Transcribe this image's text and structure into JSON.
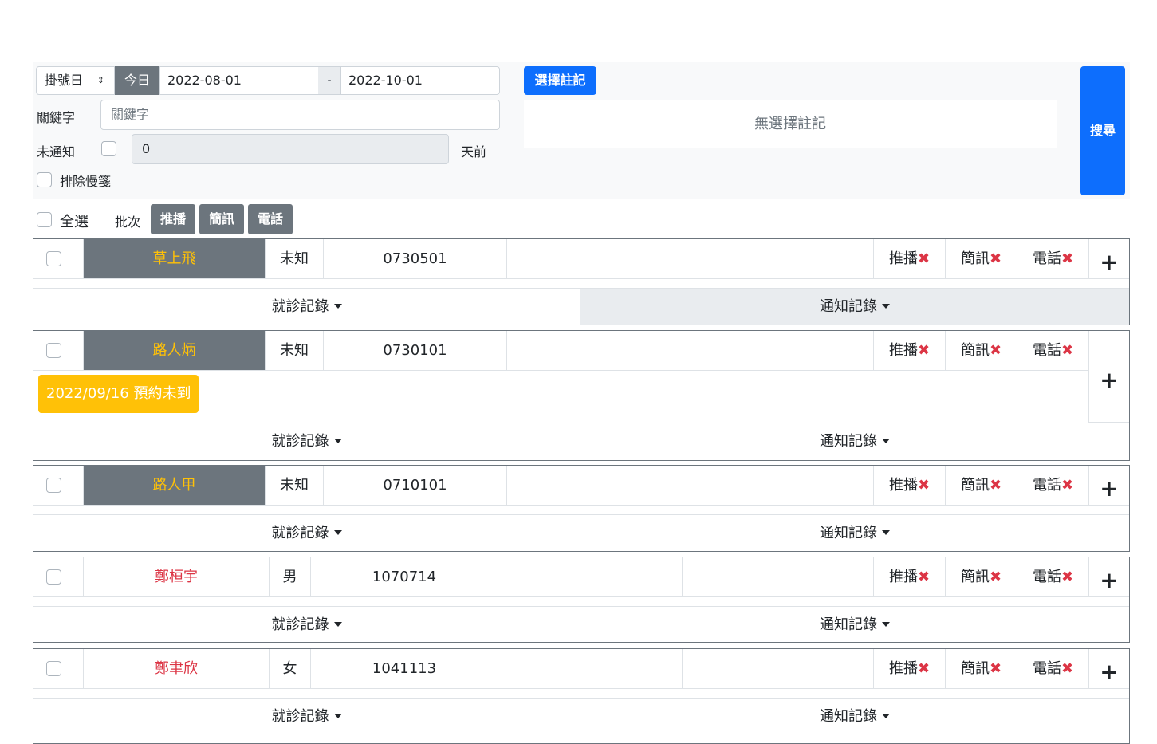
{
  "filters": {
    "date_type": "掛號日",
    "today_label": "今日",
    "date_from": "2022-08-01",
    "date_sep": "-",
    "date_to": "2022-10-01",
    "keyword_label": "關鍵字",
    "keyword_placeholder": "關鍵字",
    "unnotified_label": "未通知",
    "unnotified_days": "0",
    "days_suffix": "天前",
    "exclude_label": "排除慢箋",
    "select_note_label": "選擇註記",
    "no_note_text": "無選擇註記",
    "search_label": "搜尋"
  },
  "batch": {
    "select_all_label": "全選",
    "batch_label": "批次",
    "push_label": "推播",
    "sms_label": "簡訊",
    "phone_label": "電話"
  },
  "row_common": {
    "push_label": "推播",
    "sms_label": "簡訊",
    "phone_label": "電話",
    "x_mark": "✖",
    "plus": "+",
    "visit_records_label": "就診記錄",
    "notify_records_label": "通知記錄"
  },
  "patients": [
    {
      "name": "草上飛",
      "gender": "未知",
      "birth": "0730501",
      "name_style": "dark"
    },
    {
      "name": "路人炳",
      "gender": "未知",
      "birth": "0730101",
      "name_style": "dark",
      "badge": "2022/09/16 預約未到"
    },
    {
      "name": "路人甲",
      "gender": "未知",
      "birth": "0710101",
      "name_style": "dark"
    },
    {
      "name": "鄭桓宇",
      "gender": "男",
      "birth": "1070714",
      "name_style": "red"
    },
    {
      "name": "鄭聿欣",
      "gender": "女",
      "birth": "1041113",
      "name_style": "red"
    }
  ],
  "colors": {
    "primary": "#0d6efd",
    "secondary": "#6c757d",
    "warning": "#ffc107",
    "danger": "#dc3545"
  }
}
